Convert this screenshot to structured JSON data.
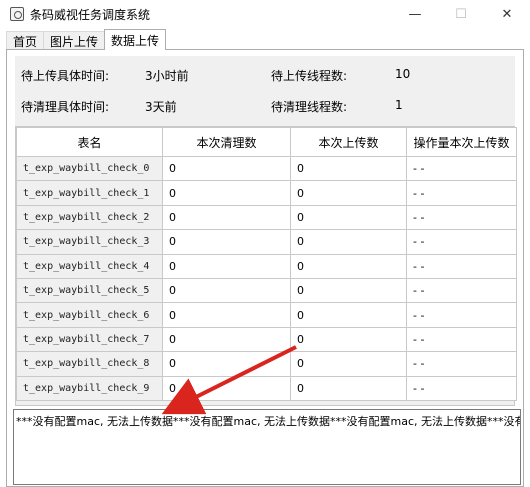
{
  "window": {
    "title": "条码威视任务调度系统",
    "min_label": "—",
    "max_label": "☐",
    "close_label": "✕"
  },
  "tabs": [
    {
      "label": "首页"
    },
    {
      "label": "图片上传"
    },
    {
      "label": "数据上传"
    }
  ],
  "info": {
    "pending_upload_time_label": "待上传具体时间:",
    "pending_upload_time_value": "3小时前",
    "upload_threads_label": "待上传线程数:",
    "upload_threads_value": "10",
    "pending_clean_time_label": "待清理具体时间:",
    "pending_clean_time_value": "3天前",
    "clean_threads_label": "待清理线程数:",
    "clean_threads_value": "1"
  },
  "table": {
    "headers": [
      "表名",
      "本次清理数",
      "本次上传数",
      "操作量本次上传数"
    ],
    "rows": [
      [
        "t_exp_waybill_check_0",
        "0",
        "0",
        "- -"
      ],
      [
        "t_exp_waybill_check_1",
        "0",
        "0",
        "- -"
      ],
      [
        "t_exp_waybill_check_2",
        "0",
        "0",
        "- -"
      ],
      [
        "t_exp_waybill_check_3",
        "0",
        "0",
        "- -"
      ],
      [
        "t_exp_waybill_check_4",
        "0",
        "0",
        "- -"
      ],
      [
        "t_exp_waybill_check_5",
        "0",
        "0",
        "- -"
      ],
      [
        "t_exp_waybill_check_6",
        "0",
        "0",
        "- -"
      ],
      [
        "t_exp_waybill_check_7",
        "0",
        "0",
        "- -"
      ],
      [
        "t_exp_waybill_check_8",
        "0",
        "0",
        "- -"
      ],
      [
        "t_exp_waybill_check_9",
        "0",
        "0",
        "- -"
      ]
    ]
  },
  "log_text": "***没有配置mac, 无法上传数据***没有配置mac, 无法上传数据***没有配置mac, 无法上传数据***没有配置",
  "colors": {
    "arrow": "#d9251d",
    "panel": "#f0f0f0",
    "border": "#c9c9c9"
  }
}
